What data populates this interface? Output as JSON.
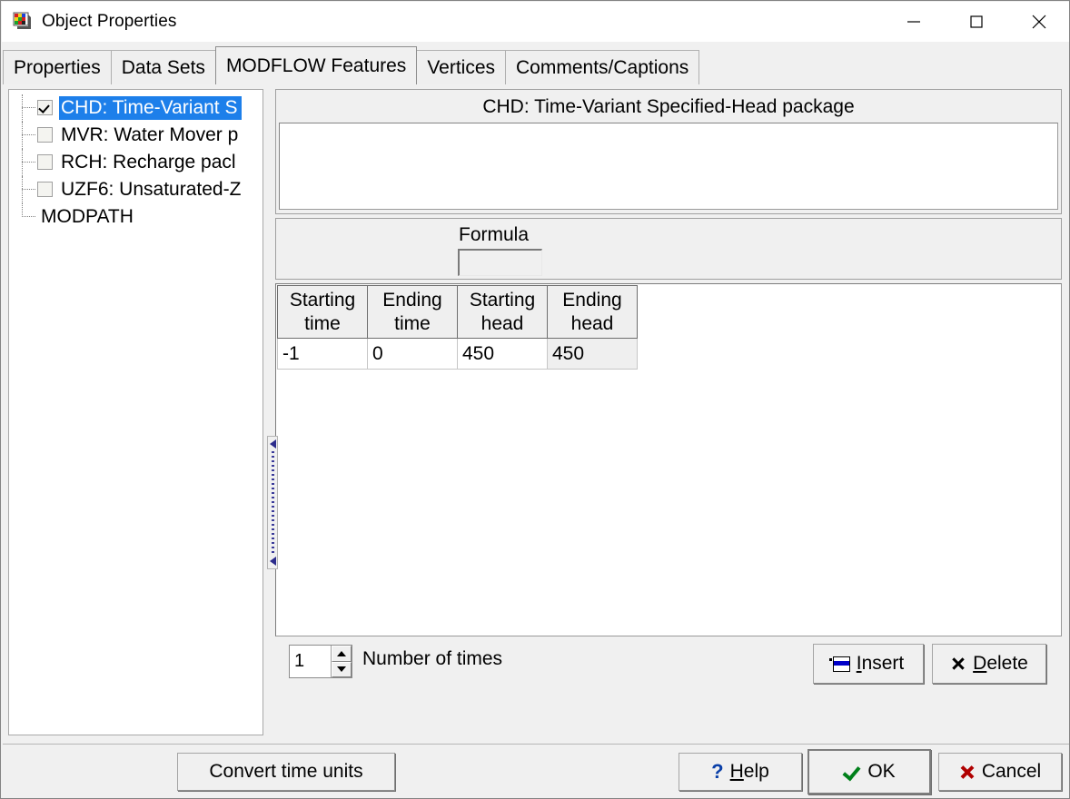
{
  "window": {
    "title": "Object Properties",
    "icon": "raster-palette-icon",
    "controls": {
      "minimize": "minimize-icon",
      "maximize": "maximize-icon",
      "close": "close-icon"
    }
  },
  "tabs": [
    {
      "label": "Properties",
      "active": false
    },
    {
      "label": "Data Sets",
      "active": false
    },
    {
      "label": "MODFLOW Features",
      "active": true
    },
    {
      "label": "Vertices",
      "active": false
    },
    {
      "label": "Comments/Captions",
      "active": false
    }
  ],
  "tree": {
    "items": [
      {
        "label": "CHD: Time-Variant S",
        "checkbox": true,
        "checked": true,
        "selected": true
      },
      {
        "label": "MVR: Water Mover p",
        "checkbox": true,
        "checked": false,
        "selected": false
      },
      {
        "label": "RCH: Recharge pacl",
        "checkbox": true,
        "checked": false,
        "selected": false
      },
      {
        "label": "UZF6: Unsaturated-Z",
        "checkbox": true,
        "checked": false,
        "selected": false
      },
      {
        "label": "MODPATH",
        "checkbox": false,
        "checked": false,
        "selected": false
      }
    ]
  },
  "package": {
    "title": "CHD: Time-Variant Specified-Head package",
    "memo_value": ""
  },
  "formula": {
    "label": "Formula",
    "value": ""
  },
  "grid": {
    "columns": [
      "Starting\ntime",
      "Ending\ntime",
      "Starting\nhead",
      "Ending\nhead"
    ],
    "headers": [
      {
        "line1": "Starting",
        "line2": "time"
      },
      {
        "line1": "Ending",
        "line2": "time"
      },
      {
        "line1": "Starting",
        "line2": "head"
      },
      {
        "line1": "Ending",
        "line2": "head"
      }
    ],
    "rows": [
      {
        "starting_time": "-1",
        "ending_time": "0",
        "starting_head": "450",
        "ending_head": "450"
      }
    ],
    "focused_cell": "ending_head"
  },
  "times": {
    "count_value": "1",
    "count_label": "Number of times",
    "spin_up": "spin-up-icon",
    "spin_down": "spin-down-icon"
  },
  "actions": {
    "insert": {
      "label_prefix": "",
      "label_underline": "I",
      "label_suffix": "nsert",
      "icon": "insert-row-icon"
    },
    "delete": {
      "label_prefix": "",
      "label_underline": "D",
      "label_suffix": "elete",
      "icon": "delete-x-icon"
    }
  },
  "footer": {
    "convert": "Convert time units",
    "help": {
      "label_underline": "H",
      "label_suffix": "elp",
      "icon": "question-mark-icon"
    },
    "ok": {
      "label": "OK",
      "icon": "check-icon"
    },
    "cancel": {
      "label": "Cancel",
      "icon": "red-x-icon"
    }
  },
  "colors": {
    "selection": "#1d7fea",
    "face": "#f0f0f0",
    "insert_icon_blue": "#0000c8",
    "ok_check_green": "#00801a",
    "cancel_x_red": "#b00000",
    "help_blue": "#0a3fa8"
  },
  "splitter": {
    "name": "grid-column-splitter"
  }
}
